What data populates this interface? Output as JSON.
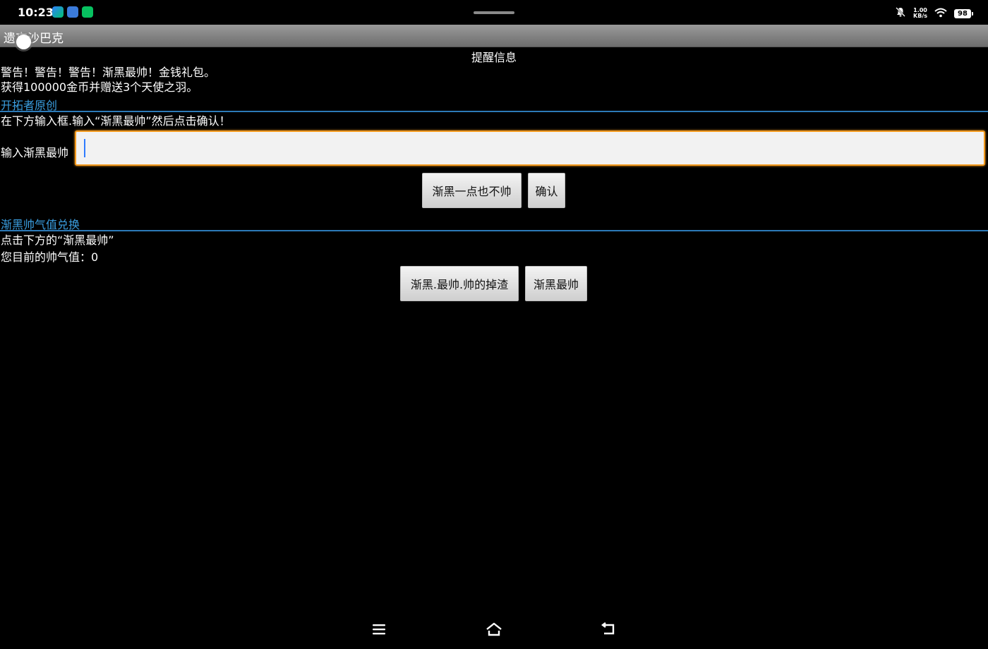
{
  "status_bar": {
    "time": "10:23",
    "net_speed_value": "1.00",
    "net_speed_unit": "KB/s",
    "battery": "98"
  },
  "app": {
    "title": "遗忘沙巴克"
  },
  "dialog": {
    "title": "提醒信息",
    "warning_line1": "警告！警告！警告！渐黑最帅！金钱礼包。",
    "warning_line2": "获得100000金币并赠送3个天使之羽。"
  },
  "section1": {
    "header": "开拓者原创",
    "instruction": "在下方输入框.输入“渐黑最帅”然后点击确认！",
    "input_label": "输入渐黑最帅",
    "input_value": "",
    "btn_deny": "渐黑一点也不帅",
    "btn_confirm": "确认"
  },
  "section2": {
    "header": "渐黑帅气值兑换",
    "instruction": "点击下方的“渐黑最帅”",
    "points_line": "您目前的帅气值：0",
    "btn_left": "渐黑.最帅.帅的掉渣",
    "btn_right": "渐黑最帅"
  }
}
